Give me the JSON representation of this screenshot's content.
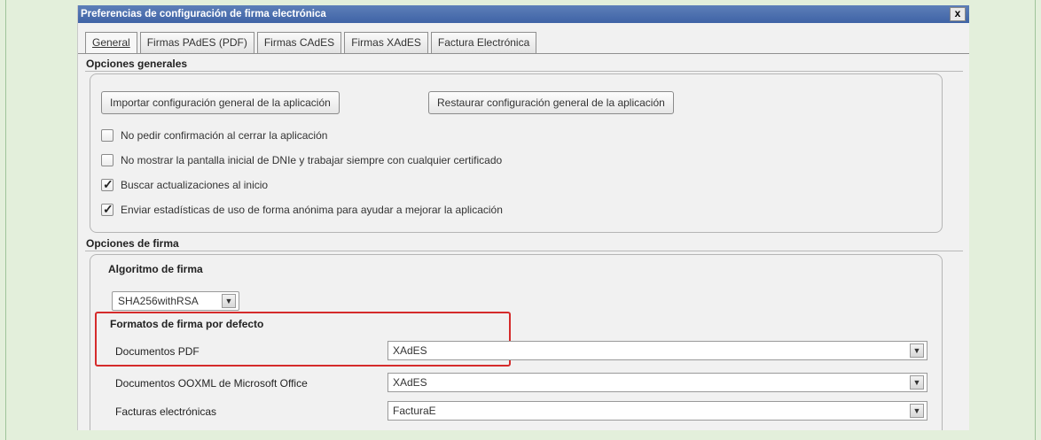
{
  "window": {
    "title": "Preferencias de configuración de firma electrónica",
    "close_label": "x"
  },
  "tabs": [
    {
      "label": "General"
    },
    {
      "label": "Firmas PAdES (PDF)"
    },
    {
      "label": "Firmas CAdES"
    },
    {
      "label": "Firmas XAdES"
    },
    {
      "label": "Factura Electrónica"
    }
  ],
  "general_options": {
    "header": "Opciones generales",
    "import_button": "Importar configuración general de la aplicación",
    "restore_button": "Restaurar configuración general de la aplicación",
    "checkboxes": [
      {
        "label": "No pedir confirmación al cerrar la aplicación",
        "checked": false
      },
      {
        "label": "No mostrar la pantalla inicial de DNIe y trabajar siempre con cualquier certificado",
        "checked": false
      },
      {
        "label": "Buscar actualizaciones al inicio",
        "checked": true
      },
      {
        "label": "Enviar estadísticas de uso de forma anónima para ayudar a mejorar la aplicación",
        "checked": true
      }
    ]
  },
  "signature_options": {
    "header": "Opciones de firma",
    "algorithm_label": "Algoritmo de firma",
    "algorithm_value": "SHA256withRSA",
    "default_formats_label": "Formatos de firma por defecto",
    "formats": [
      {
        "label": "Documentos PDF",
        "value": "XAdES"
      },
      {
        "label": "Documentos OOXML de Microsoft Office",
        "value": "XAdES"
      },
      {
        "label": "Facturas electrónicas",
        "value": "FacturaE"
      }
    ]
  },
  "colors": {
    "titlebar": "#3f63a6",
    "highlight": "#d52b2b",
    "page_background": "#e3efdb"
  }
}
